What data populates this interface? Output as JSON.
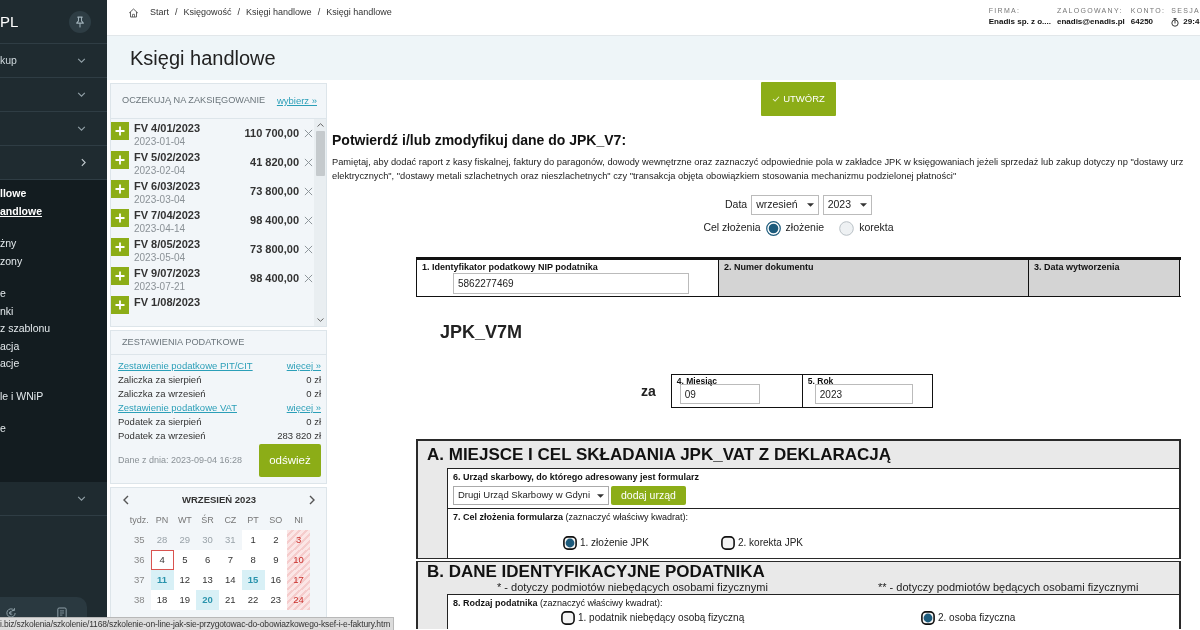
{
  "sidebar": {
    "brand": "PL",
    "items": [
      {
        "label": "kup",
        "kind": "dropdown"
      },
      {
        "kind": "dropdown"
      },
      {
        "kind": "dropdown"
      },
      {
        "kind": "flyout"
      }
    ],
    "submenu": [
      [
        {
          "label": "llowe",
          "kind": "heading",
          "selected": false
        },
        {
          "label": "andlowe",
          "kind": "link",
          "selected": true
        }
      ],
      [
        {
          "label": "żny",
          "kind": "link",
          "selected": false
        },
        {
          "label": "zony",
          "kind": "link",
          "selected": false
        }
      ],
      [
        {
          "label": "e",
          "kind": "link",
          "selected": false
        },
        {
          "label": "nki",
          "kind": "link",
          "selected": false
        },
        {
          "label": "z szablonu",
          "kind": "link",
          "selected": false
        },
        {
          "label": "acja",
          "kind": "link",
          "selected": false
        },
        {
          "label": "acje",
          "kind": "link",
          "selected": false
        }
      ],
      [
        {
          "label": "le i WNiP",
          "kind": "link",
          "selected": false
        }
      ],
      [
        {
          "label": "e",
          "kind": "link",
          "selected": false
        }
      ]
    ],
    "bottom_items": [
      {
        "kind": "dropdown"
      }
    ]
  },
  "breadcrumb": {
    "separator": "/",
    "items": [
      "Start",
      "Księgowość",
      "Księgi handlowe",
      "Księgi handlowe"
    ]
  },
  "account": [
    {
      "label": "FIRMA:",
      "value": "Enadis sp. z o....",
      "kind": "text"
    },
    {
      "label": "ZALOGOWANY:",
      "value": "enadis@enadis.pl",
      "kind": "text"
    },
    {
      "label": "KONTO:",
      "value": "64250",
      "kind": "text"
    },
    {
      "label": "SESJA",
      "value": "29:4",
      "kind": "timer"
    }
  ],
  "page_title": "Księgi handlowe",
  "pending": {
    "title": "OCZEKUJĄ NA ZAKSIĘGOWANIE",
    "link": "wybierz »",
    "items": [
      {
        "number": "FV 4/01/2023",
        "date": "2023-01-04",
        "amount": "110 700,00"
      },
      {
        "number": "FV 5/02/2023",
        "date": "2023-02-04",
        "amount": "41 820,00"
      },
      {
        "number": "FV 6/03/2023",
        "date": "2023-03-04",
        "amount": "73 800,00"
      },
      {
        "number": "FV 7/04/2023",
        "date": "2023-04-14",
        "amount": "98 400,00"
      },
      {
        "number": "FV 8/05/2023",
        "date": "2023-05-04",
        "amount": "73 800,00"
      },
      {
        "number": "FV 9/07/2023",
        "date": "2023-07-21",
        "amount": "98 400,00"
      },
      {
        "number": "FV 1/08/2023"
      }
    ]
  },
  "tax_summary": {
    "title": "ZESTAWIENIA PODATKOWE",
    "rows": [
      {
        "kind": "link",
        "label": "Zestawienie podatkowe PIT/CIT",
        "value": "więcej »"
      },
      {
        "kind": "value",
        "label": "Zaliczka za sierpień",
        "value": "0 zł"
      },
      {
        "kind": "value",
        "label": "Zaliczka za wrzesień",
        "value": "0 zł"
      },
      {
        "kind": "link",
        "label": "Zestawienie podatkowe VAT",
        "value": "więcej »"
      },
      {
        "kind": "value",
        "label": "Podatek za sierpień",
        "value": "0 zł"
      },
      {
        "kind": "value",
        "label": "Podatek za wrzesień",
        "value": "283 820 zł"
      }
    ],
    "updated": "Dane z dnia: 2023-09-04 16:28",
    "refresh": "odśwież"
  },
  "calendar": {
    "title": "WRZESIEŃ 2023",
    "weekdays": [
      "tydz.",
      "PN",
      "WT",
      "ŚR",
      "CZ",
      "PT",
      "SO",
      "NI"
    ],
    "weeks": [
      {
        "number": "35",
        "days": [
          {
            "day": "28",
            "kind": "outside"
          },
          {
            "day": "29",
            "kind": "outside"
          },
          {
            "day": "30",
            "kind": "outside"
          },
          {
            "day": "31",
            "kind": "outside"
          },
          {
            "day": "1",
            "kind": "plain"
          },
          {
            "day": "2",
            "kind": "plain"
          },
          {
            "day": "3",
            "kind": "sunday"
          }
        ]
      },
      {
        "number": "36",
        "days": [
          {
            "day": "4",
            "kind": "today"
          },
          {
            "day": "5",
            "kind": "plain"
          },
          {
            "day": "6",
            "kind": "plain"
          },
          {
            "day": "7",
            "kind": "plain"
          },
          {
            "day": "8",
            "kind": "plain"
          },
          {
            "day": "9",
            "kind": "plain"
          },
          {
            "day": "10",
            "kind": "sunday"
          }
        ]
      },
      {
        "number": "37",
        "days": [
          {
            "day": "11",
            "kind": "event"
          },
          {
            "day": "12",
            "kind": "plain"
          },
          {
            "day": "13",
            "kind": "plain"
          },
          {
            "day": "14",
            "kind": "plain"
          },
          {
            "day": "15",
            "kind": "event"
          },
          {
            "day": "16",
            "kind": "plain"
          },
          {
            "day": "17",
            "kind": "sunday"
          }
        ]
      },
      {
        "number": "38",
        "days": [
          {
            "day": "18",
            "kind": "plain"
          },
          {
            "day": "19",
            "kind": "plain"
          },
          {
            "day": "20",
            "kind": "event"
          },
          {
            "day": "21",
            "kind": "plain"
          },
          {
            "day": "22",
            "kind": "plain"
          },
          {
            "day": "23",
            "kind": "plain"
          },
          {
            "day": "24",
            "kind": "sunday"
          }
        ]
      }
    ]
  },
  "form": {
    "create_button": "UTWÓRZ",
    "heading": "Potwierdź i/lub zmodyfikuj dane do JPK_V7:",
    "note_lines": [
      "Pamiętaj, aby dodać raport z kasy fiskalnej, faktury do paragonów, dowody wewnętrzne oraz zaznaczyć odpowiednie pola w zakładce JPK w księgowaniach jeżeli sprzedaż lub zakup dotyczy np \"dostawy urz",
      "elektrycznych\", \"dostawy metali szlachetnych oraz nieszlachetnych\" czy \"transakcja objęta obowiązkiem stosowania mechanizmu podzielonej płatności\""
    ],
    "date_label": "Data",
    "month": "wrzesień",
    "year": "2023",
    "purpose_label": "Cel złożenia",
    "purpose_options": [
      {
        "label": "złożenie",
        "selected": true
      },
      {
        "label": "korekta",
        "selected": false
      }
    ],
    "header_cells": [
      {
        "label": "1. Identyfikator podatkowy NIP podatnika",
        "kind": "input",
        "value": "5862277469"
      },
      {
        "label": "2. Numer dokumentu",
        "kind": "readonly"
      },
      {
        "label": "3. Data wytworzenia",
        "kind": "readonly"
      }
    ],
    "form_code": "JPK_V7M",
    "period_label": "za",
    "period_cells": [
      {
        "label": "4. Miesiąc",
        "value": "09"
      },
      {
        "label": "5. Rok",
        "value": "2023"
      }
    ],
    "sections": [
      {
        "title": "A. MIEJSCE I CEL SKŁADANIA JPK_VAT Z DEKLARACJĄ",
        "fields": [
          {
            "kind": "office",
            "label": "6. Urząd skarbowy, do którego adresowany jest formularz",
            "value": "Drugi Urząd Skarbowy w Gdyni",
            "button": "dodaj urząd"
          },
          {
            "kind": "choice",
            "label": "**7. Cel złożenia formularza** (zaznaczyć właściwy kwadrat):",
            "options": [
              {
                "label": "1. złożenie JPK",
                "selected": true
              },
              {
                "label": "2. korekta JPK",
                "selected": false
              }
            ]
          }
        ]
      },
      {
        "title": "B. DANE IDENTYFIKACYJNE PODATNIKA",
        "notes": [
          "* - dotyczy podmiotów niebędących osobami fizycznymi",
          "** - dotyczy podmiotów będących osobami fizycznymi"
        ],
        "fields": [
          {
            "kind": "choice",
            "label": "**8. Rodzaj podatnika** (zaznaczyć właściwy kwadrat):",
            "options": [
              {
                "label": "1. podatnik niebędący osobą fizyczną",
                "selected": false
              },
              {
                "label": "2. osoba fizyczna",
                "selected": true
              }
            ]
          }
        ]
      }
    ]
  },
  "status_url": "i.biz/szkolenia/szkolenie/1168/szkolenie-on-line-jak-sie-przygotowac-do-obowiazkowego-ksef-i-e-faktury.htm"
}
